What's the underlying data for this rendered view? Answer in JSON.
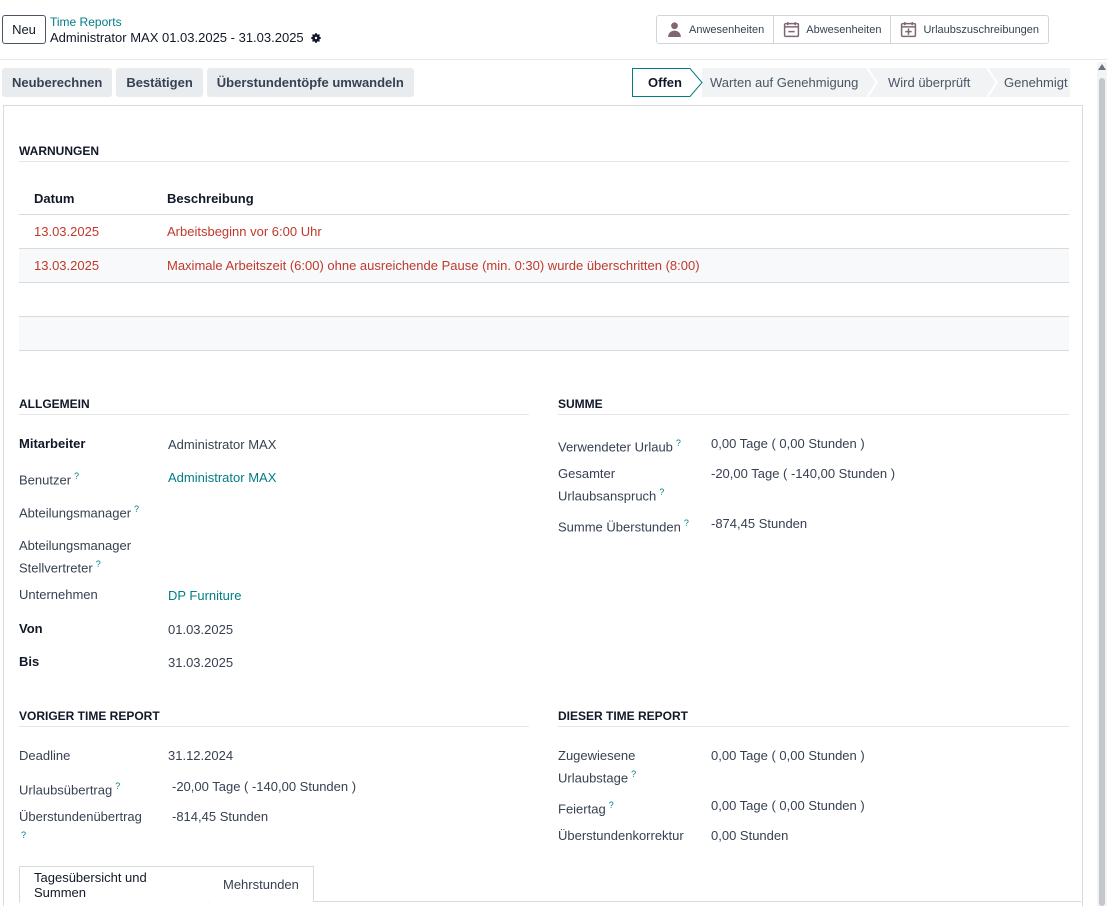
{
  "control_panel": {
    "new_label": "Neu",
    "breadcrumb_parent": "Time Reports",
    "breadcrumb_current": "Administrator MAX 01.03.2025 - 31.03.2025",
    "smart_buttons": [
      {
        "label": "Anwesenheiten",
        "icon": "user-icon"
      },
      {
        "label": "Abwesenheiten",
        "icon": "calendar-minus-icon"
      },
      {
        "label": "Urlaubszuschreibungen",
        "icon": "calendar-plus-icon"
      }
    ]
  },
  "statusbar": {
    "actions": [
      "Neuberechnen",
      "Bestätigen",
      "Überstundentöpfe umwandeln"
    ],
    "stages": [
      "Offen",
      "Warten auf Genehmigung",
      "Wird überprüft",
      "Genehmigt"
    ],
    "active_stage": "Offen"
  },
  "warnings": {
    "title": "WARNUNGEN",
    "columns": [
      "Datum",
      "Beschreibung"
    ],
    "rows": [
      {
        "date": "13.03.2025",
        "description": "Arbeitsbeginn vor 6:00 Uhr"
      },
      {
        "date": "13.03.2025",
        "description": "Maximale Arbeitszeit (6:00) ohne ausreichende Pause (min. 0:30) wurde überschritten (8:00)"
      }
    ]
  },
  "general": {
    "title": "ALLGEMEIN",
    "employee_label": "Mitarbeiter",
    "employee_value": "Administrator MAX",
    "user_label": "Benutzer",
    "user_value": "Administrator MAX",
    "manager_label": "Abteilungsmanager",
    "deputy_label_1": "Abteilungsmanager",
    "deputy_label_2": "Stellvertreter",
    "company_label": "Unternehmen",
    "company_value": "DP Furniture",
    "from_label": "Von",
    "from_value": "01.03.2025",
    "to_label": "Bis",
    "to_value": "31.03.2025"
  },
  "sum": {
    "title": "SUMME",
    "used_vacation_label": "Verwendeter Urlaub",
    "used_vacation_value": "0,00 Tage  ( 0,00 Stunden )",
    "total_entitlement_label_1": "Gesamter",
    "total_entitlement_label_2": "Urlaubsanspruch",
    "total_entitlement_value": "-20,00 Tage  ( -140,00 Stunden )",
    "overtime_sum_label": "Summe Überstunden",
    "overtime_sum_value": "-874,45 Stunden"
  },
  "previous_report": {
    "title": "VORIGER TIME REPORT",
    "deadline_label": "Deadline",
    "deadline_value": "31.12.2024",
    "vacation_carry_label": "Urlaubsübertrag",
    "vacation_carry_value": "-20,00 Tage  ( -140,00 Stunden )",
    "overtime_carry_label": "Überstundenübertrag",
    "overtime_carry_value": "-814,45 Stunden"
  },
  "this_report": {
    "title": "DIESER TIME REPORT",
    "assigned_days_label_1": "Zugewiesene",
    "assigned_days_label_2": "Urlaubstage",
    "assigned_days_value": "0,00 Tage  ( 0,00 Stunden )",
    "holiday_label": "Feiertag",
    "holiday_value": "0,00 Tage  ( 0,00 Stunden )",
    "overtime_correction_label": "Überstundenkorrektur",
    "overtime_correction_value": "0,00 Stunden"
  },
  "tabs": [
    "Tagesübersicht und Summen",
    "Mehrstunden"
  ],
  "help_marker": "?",
  "colors": {
    "accent": "#017e84",
    "warning": "#c0392b",
    "user_icon": "#7e6773"
  }
}
